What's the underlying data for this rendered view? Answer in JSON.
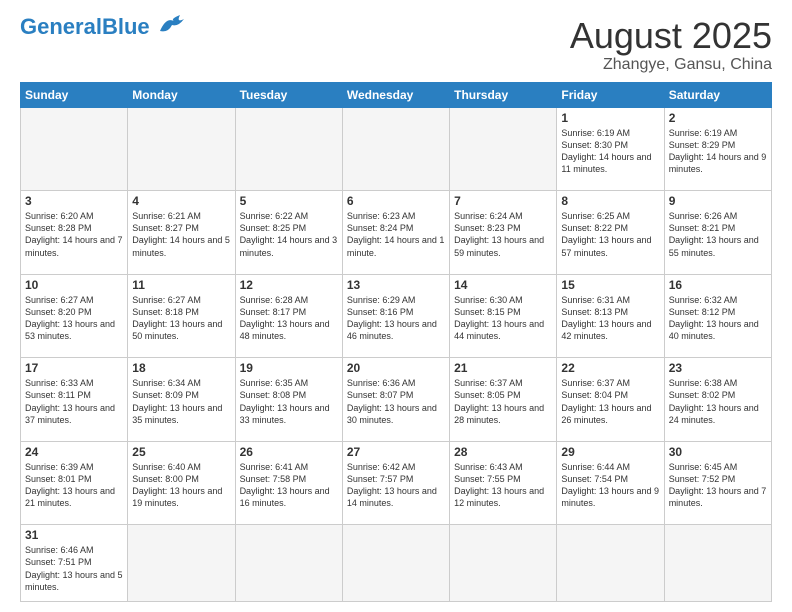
{
  "header": {
    "logo_general": "General",
    "logo_blue": "Blue",
    "title": "August 2025",
    "subtitle": "Zhangye, Gansu, China"
  },
  "weekdays": [
    "Sunday",
    "Monday",
    "Tuesday",
    "Wednesday",
    "Thursday",
    "Friday",
    "Saturday"
  ],
  "weeks": [
    [
      {
        "day": "",
        "info": ""
      },
      {
        "day": "",
        "info": ""
      },
      {
        "day": "",
        "info": ""
      },
      {
        "day": "",
        "info": ""
      },
      {
        "day": "",
        "info": ""
      },
      {
        "day": "1",
        "info": "Sunrise: 6:19 AM\nSunset: 8:30 PM\nDaylight: 14 hours and 11 minutes."
      },
      {
        "day": "2",
        "info": "Sunrise: 6:19 AM\nSunset: 8:29 PM\nDaylight: 14 hours and 9 minutes."
      }
    ],
    [
      {
        "day": "3",
        "info": "Sunrise: 6:20 AM\nSunset: 8:28 PM\nDaylight: 14 hours and 7 minutes."
      },
      {
        "day": "4",
        "info": "Sunrise: 6:21 AM\nSunset: 8:27 PM\nDaylight: 14 hours and 5 minutes."
      },
      {
        "day": "5",
        "info": "Sunrise: 6:22 AM\nSunset: 8:25 PM\nDaylight: 14 hours and 3 minutes."
      },
      {
        "day": "6",
        "info": "Sunrise: 6:23 AM\nSunset: 8:24 PM\nDaylight: 14 hours and 1 minute."
      },
      {
        "day": "7",
        "info": "Sunrise: 6:24 AM\nSunset: 8:23 PM\nDaylight: 13 hours and 59 minutes."
      },
      {
        "day": "8",
        "info": "Sunrise: 6:25 AM\nSunset: 8:22 PM\nDaylight: 13 hours and 57 minutes."
      },
      {
        "day": "9",
        "info": "Sunrise: 6:26 AM\nSunset: 8:21 PM\nDaylight: 13 hours and 55 minutes."
      }
    ],
    [
      {
        "day": "10",
        "info": "Sunrise: 6:27 AM\nSunset: 8:20 PM\nDaylight: 13 hours and 53 minutes."
      },
      {
        "day": "11",
        "info": "Sunrise: 6:27 AM\nSunset: 8:18 PM\nDaylight: 13 hours and 50 minutes."
      },
      {
        "day": "12",
        "info": "Sunrise: 6:28 AM\nSunset: 8:17 PM\nDaylight: 13 hours and 48 minutes."
      },
      {
        "day": "13",
        "info": "Sunrise: 6:29 AM\nSunset: 8:16 PM\nDaylight: 13 hours and 46 minutes."
      },
      {
        "day": "14",
        "info": "Sunrise: 6:30 AM\nSunset: 8:15 PM\nDaylight: 13 hours and 44 minutes."
      },
      {
        "day": "15",
        "info": "Sunrise: 6:31 AM\nSunset: 8:13 PM\nDaylight: 13 hours and 42 minutes."
      },
      {
        "day": "16",
        "info": "Sunrise: 6:32 AM\nSunset: 8:12 PM\nDaylight: 13 hours and 40 minutes."
      }
    ],
    [
      {
        "day": "17",
        "info": "Sunrise: 6:33 AM\nSunset: 8:11 PM\nDaylight: 13 hours and 37 minutes."
      },
      {
        "day": "18",
        "info": "Sunrise: 6:34 AM\nSunset: 8:09 PM\nDaylight: 13 hours and 35 minutes."
      },
      {
        "day": "19",
        "info": "Sunrise: 6:35 AM\nSunset: 8:08 PM\nDaylight: 13 hours and 33 minutes."
      },
      {
        "day": "20",
        "info": "Sunrise: 6:36 AM\nSunset: 8:07 PM\nDaylight: 13 hours and 30 minutes."
      },
      {
        "day": "21",
        "info": "Sunrise: 6:37 AM\nSunset: 8:05 PM\nDaylight: 13 hours and 28 minutes."
      },
      {
        "day": "22",
        "info": "Sunrise: 6:37 AM\nSunset: 8:04 PM\nDaylight: 13 hours and 26 minutes."
      },
      {
        "day": "23",
        "info": "Sunrise: 6:38 AM\nSunset: 8:02 PM\nDaylight: 13 hours and 24 minutes."
      }
    ],
    [
      {
        "day": "24",
        "info": "Sunrise: 6:39 AM\nSunset: 8:01 PM\nDaylight: 13 hours and 21 minutes."
      },
      {
        "day": "25",
        "info": "Sunrise: 6:40 AM\nSunset: 8:00 PM\nDaylight: 13 hours and 19 minutes."
      },
      {
        "day": "26",
        "info": "Sunrise: 6:41 AM\nSunset: 7:58 PM\nDaylight: 13 hours and 16 minutes."
      },
      {
        "day": "27",
        "info": "Sunrise: 6:42 AM\nSunset: 7:57 PM\nDaylight: 13 hours and 14 minutes."
      },
      {
        "day": "28",
        "info": "Sunrise: 6:43 AM\nSunset: 7:55 PM\nDaylight: 13 hours and 12 minutes."
      },
      {
        "day": "29",
        "info": "Sunrise: 6:44 AM\nSunset: 7:54 PM\nDaylight: 13 hours and 9 minutes."
      },
      {
        "day": "30",
        "info": "Sunrise: 6:45 AM\nSunset: 7:52 PM\nDaylight: 13 hours and 7 minutes."
      }
    ],
    [
      {
        "day": "31",
        "info": "Sunrise: 6:46 AM\nSunset: 7:51 PM\nDaylight: 13 hours and 5 minutes."
      },
      {
        "day": "",
        "info": ""
      },
      {
        "day": "",
        "info": ""
      },
      {
        "day": "",
        "info": ""
      },
      {
        "day": "",
        "info": ""
      },
      {
        "day": "",
        "info": ""
      },
      {
        "day": "",
        "info": ""
      }
    ]
  ]
}
